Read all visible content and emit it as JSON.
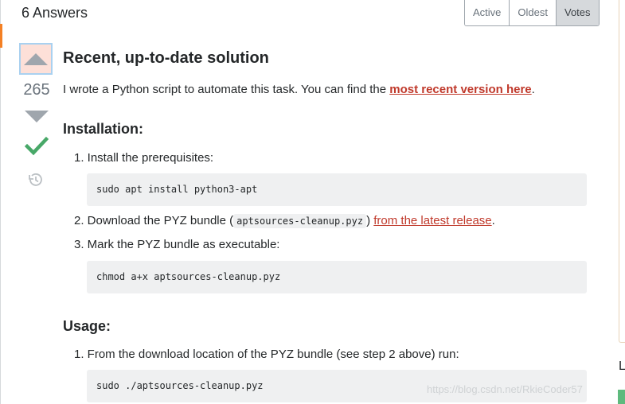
{
  "header": {
    "answers_count": "6 Answers",
    "tabs": [
      {
        "label": "Active"
      },
      {
        "label": "Oldest"
      },
      {
        "label": "Votes",
        "active": true
      }
    ]
  },
  "vote": {
    "count": "265",
    "up_icon": "upvote-arrow-icon",
    "down_icon": "downvote-arrow-icon",
    "accepted_icon": "checkmark-icon",
    "history_icon": "history-icon",
    "accepted_color": "#48a868"
  },
  "post": {
    "title": "Recent, up-to-date solution",
    "intro_text": "I wrote a Python script to automate this task. You can find the ",
    "intro_link": "most recent version here",
    "intro_end": ".",
    "installation": {
      "heading": "Installation:",
      "step1": "1. Install the prerequisites:",
      "code1": "sudo apt install python3-apt",
      "step2_a": "2. Download the PYZ bundle (",
      "step2_code": "aptsources-cleanup.pyz",
      "step2_b": ") ",
      "step2_link": "from the latest release",
      "step2_end": ".",
      "step3": "3. Mark the PYZ bundle as executable:",
      "code3": "chmod a+x aptsources-cleanup.pyz"
    },
    "usage": {
      "heading": "Usage:",
      "step1": "1. From the download location of the PYZ bundle (see step 2 above) run:",
      "code1": "sudo ./aptsources-cleanup.pyz"
    },
    "link_color": "#c0392b"
  },
  "sidebar": {
    "letter": "L"
  },
  "watermark": "https://blog.csdn.net/RkieCoder57"
}
